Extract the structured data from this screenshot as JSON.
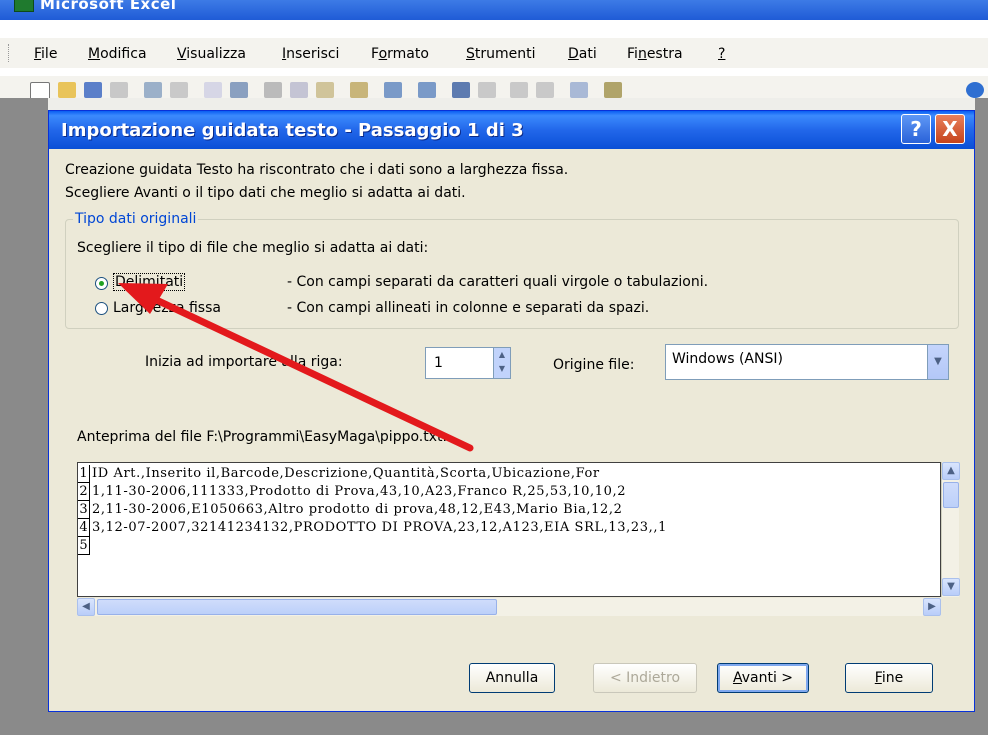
{
  "app": {
    "title": "Microsoft Excel"
  },
  "menu": {
    "items": [
      {
        "label": "File",
        "accel": "F",
        "rest": "ile"
      },
      {
        "label": "Modifica",
        "accel": "M",
        "rest": "odifica"
      },
      {
        "label": "Visualizza",
        "accel": "V",
        "rest": "isualizza"
      },
      {
        "label": "Inserisci",
        "accel": "I",
        "rest": "nserisci"
      },
      {
        "label": "Formato",
        "pre": "F",
        "accel": "o",
        "rest": "rmato"
      },
      {
        "label": "Strumenti",
        "accel": "S",
        "rest": "trumenti"
      },
      {
        "label": "Dati",
        "accel": "D",
        "rest": "ati"
      },
      {
        "label": "Finestra",
        "pre": "Fi",
        "accel": "n",
        "rest": "estra"
      },
      {
        "label": "?",
        "accel": "?",
        "rest": ""
      }
    ]
  },
  "dialog": {
    "title": "Importazione guidata testo - Passaggio 1 di 3",
    "help_button": "?",
    "close_button": "X",
    "intro_line1": "Creazione guidata Testo ha riscontrato che i dati sono a larghezza fissa.",
    "intro_line2": "Scegliere Avanti o il tipo dati che meglio si adatta ai dati.",
    "group_title": "Tipo dati originali",
    "group_prompt": "Scegliere il tipo di file che meglio si adatta ai dati:",
    "option_delimited": "Delimitati",
    "option_delimited_desc": "- Con campi separati da caratteri quali virgole o tabulazioni.",
    "option_fixed": "Larghezza fissa",
    "option_fixed_desc": "- Con campi allineati in colonne e separati da spazi.",
    "start_row_label": "Inizia ad importare alla riga:",
    "start_row_value": "1",
    "origin_label": "Origine file:",
    "origin_value": "Windows (ANSI)",
    "preview_label": "Anteprima del file F:\\Programmi\\EasyMaga\\pippo.txt.",
    "preview_rows": [
      {
        "num": "1",
        "text": "ID Art.,Inserito il,Barcode,Descrizione,Quantità,Scorta,Ubicazione,For"
      },
      {
        "num": "2",
        "text": "1,11-30-2006,111333,Prodotto di Prova,43,10,A23,Franco R,25,53,10,10,2"
      },
      {
        "num": "3",
        "text": "2,11-30-2006,E1050663,Altro prodotto di prova,48,12,E43,Mario Bia,12,2"
      },
      {
        "num": "4",
        "text": "3,12-07-2007,32141234132,PRODOTTO DI PROVA,23,12,A123,EIA SRL,13,23,,1"
      },
      {
        "num": "5",
        "text": ""
      }
    ],
    "buttons": {
      "cancel": "Annulla",
      "back": "< Indietro",
      "next": "Avanti >",
      "finish": "Fine"
    }
  }
}
